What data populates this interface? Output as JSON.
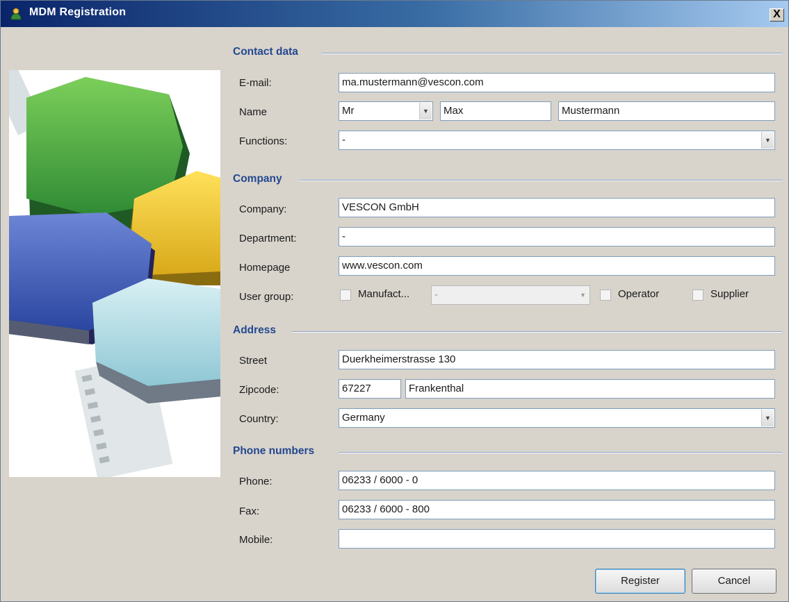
{
  "window": {
    "title": "MDM Registration",
    "close_label": "X"
  },
  "sections": {
    "contact": "Contact data",
    "company": "Company",
    "address": "Address",
    "phone": "Phone numbers"
  },
  "contact": {
    "email_label": "E-mail:",
    "email_value": "ma.mustermann@vescon.com",
    "name_label": "Name",
    "salutation": "Mr",
    "first_name": "Max",
    "last_name": "Mustermann",
    "functions_label": "Functions:",
    "functions_value": "-"
  },
  "company": {
    "company_label": "Company:",
    "company_value": "VESCON GmbH",
    "department_label": "Department:",
    "department_value": "-",
    "homepage_label": "Homepage",
    "homepage_value": "www.vescon.com",
    "usergroup_label": "User group:",
    "manufacturer_label": "Manufact...",
    "manufacturer_select": "-",
    "operator_label": "Operator",
    "supplier_label": "Supplier"
  },
  "address": {
    "street_label": "Street",
    "street_value": "Duerkheimerstrasse 130",
    "zipcode_label": "Zipcode:",
    "zipcode_value": "67227",
    "city_value": "Frankenthal",
    "country_label": "Country:",
    "country_value": "Germany"
  },
  "phones": {
    "phone_label": "Phone:",
    "phone_value": "06233 / 6000 - 0",
    "fax_label": "Fax:",
    "fax_value": "06233 / 6000 - 800",
    "mobile_label": "Mobile:",
    "mobile_value": ""
  },
  "buttons": {
    "register": "Register",
    "cancel": "Cancel"
  },
  "colors": {
    "section_title": "#23488f",
    "titlebar_start": "#0a246a",
    "titlebar_end": "#a6caf0"
  }
}
